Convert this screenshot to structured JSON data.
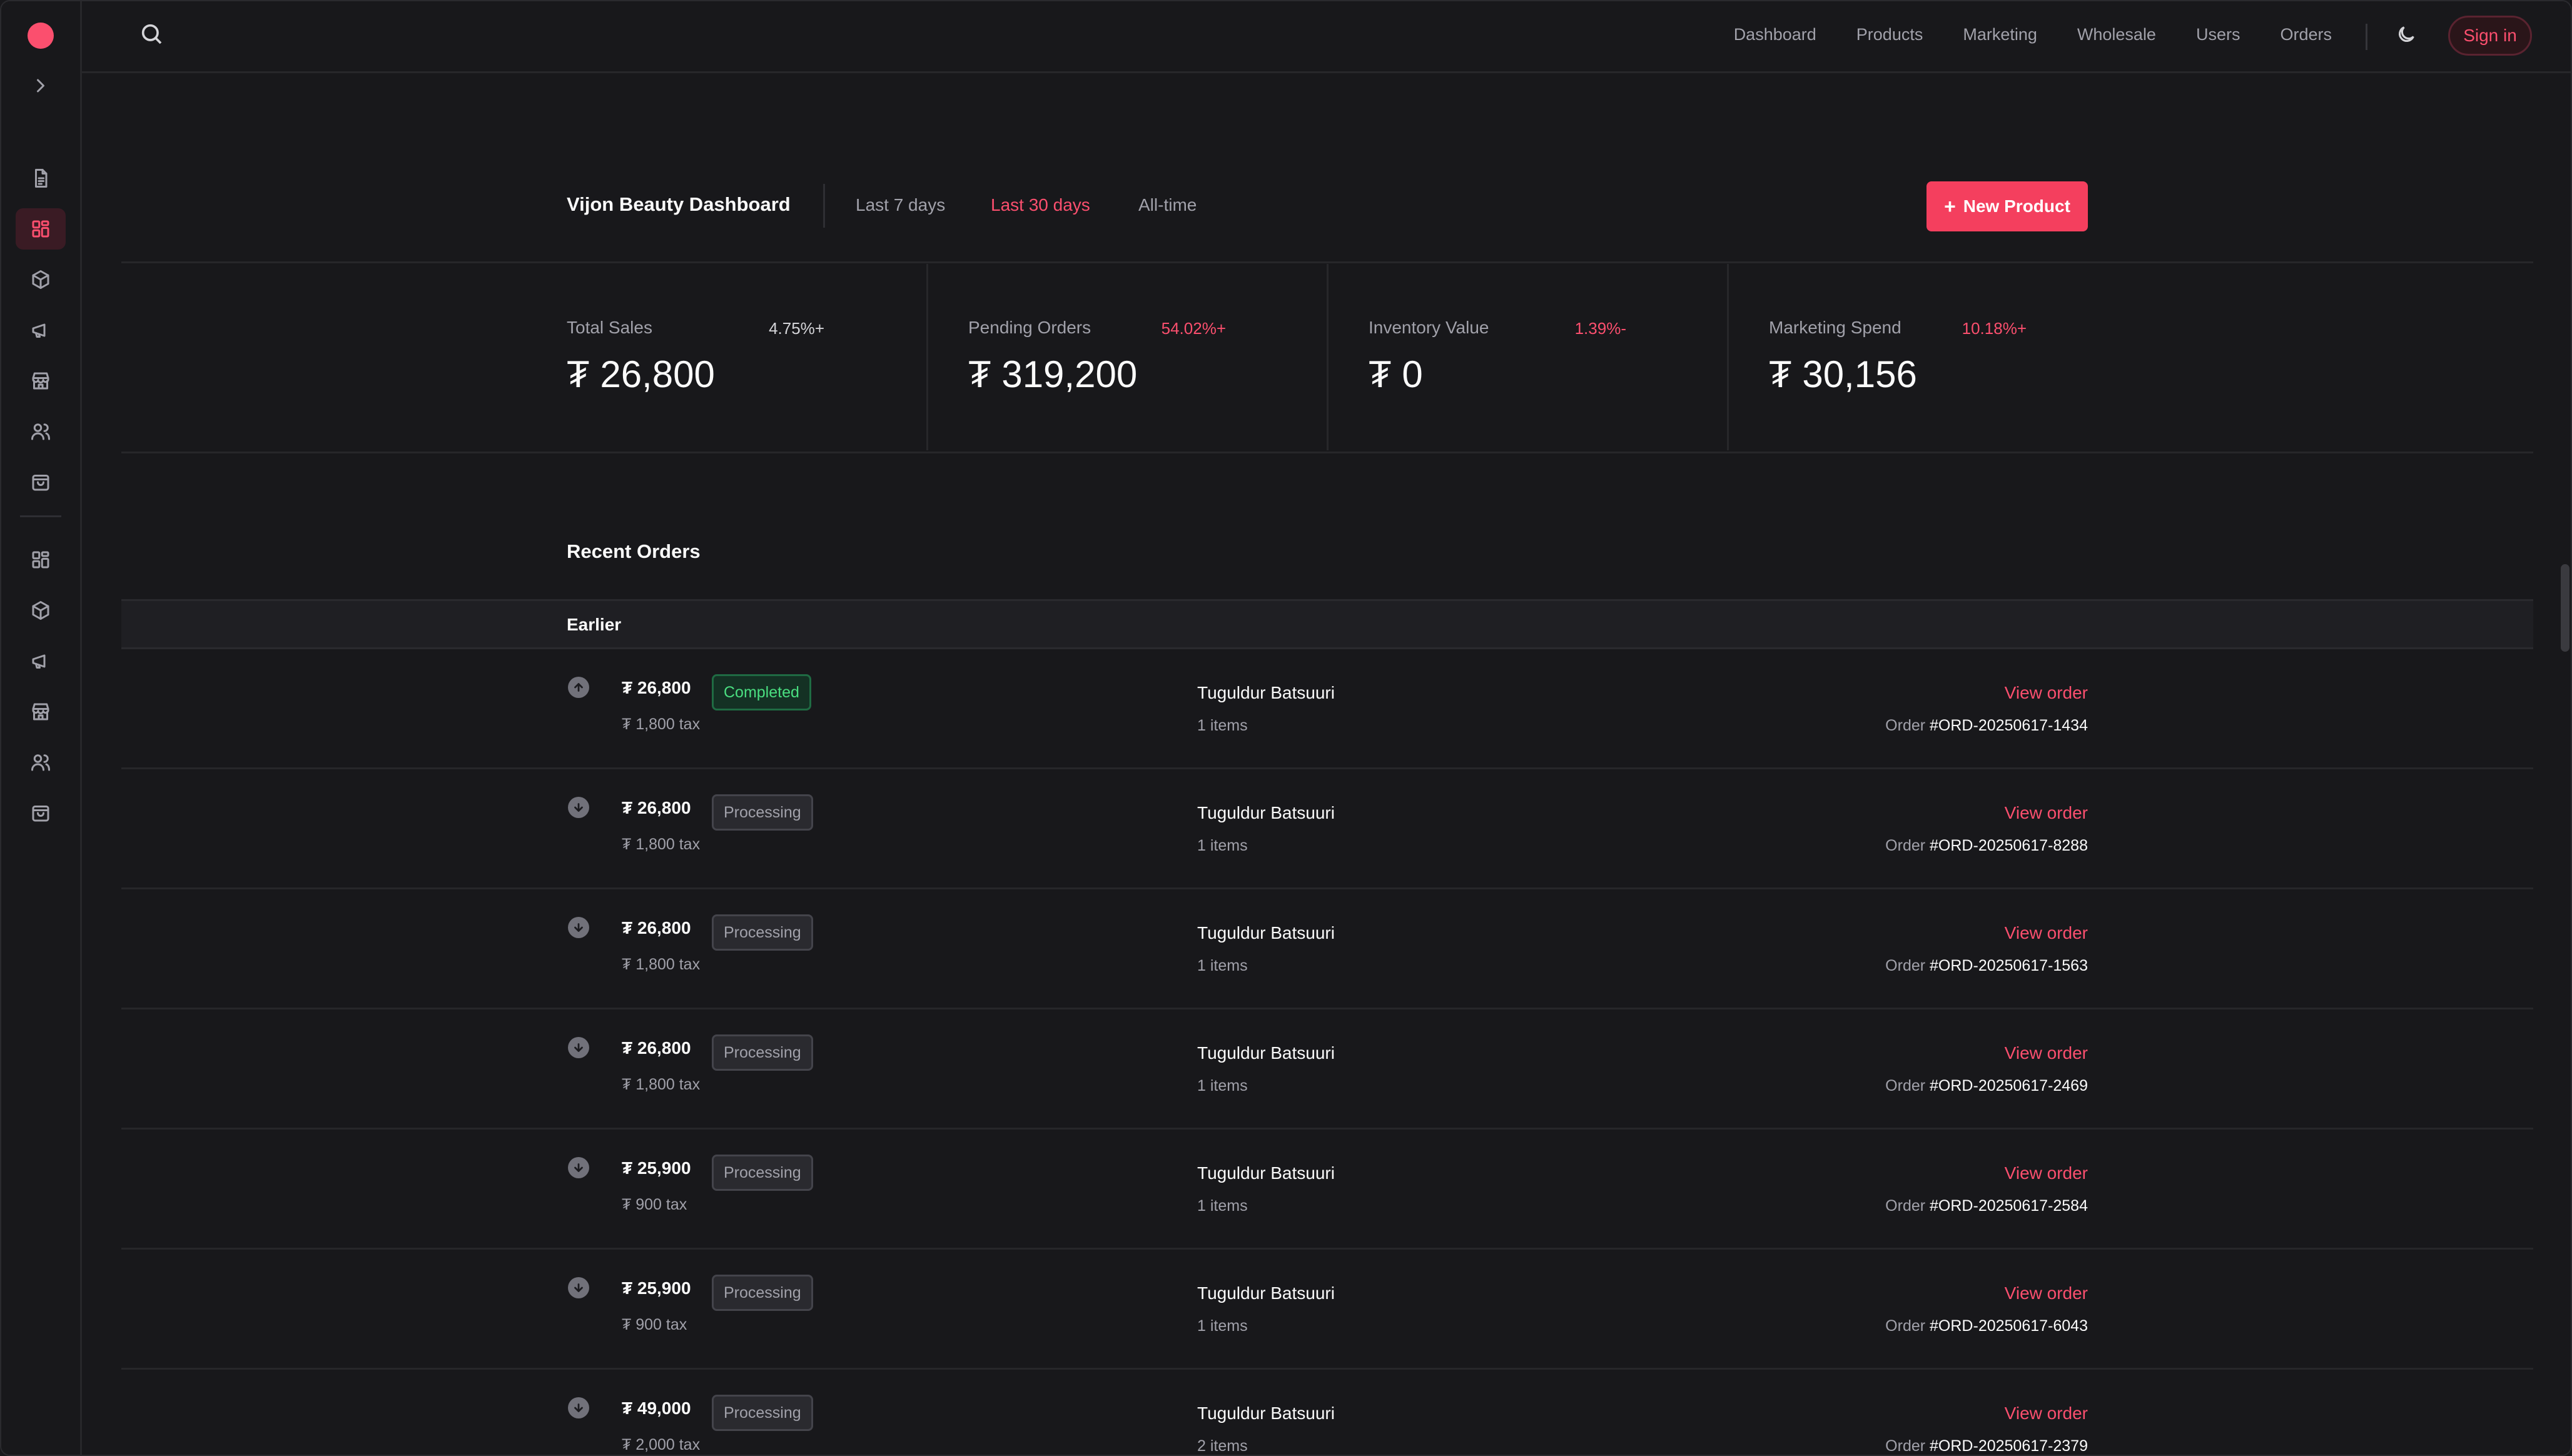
{
  "nav": {
    "items": [
      "Dashboard",
      "Products",
      "Marketing",
      "Wholesale",
      "Users",
      "Orders"
    ],
    "sign_in": "Sign in"
  },
  "sidebar": {
    "top_icons": [
      "document-icon",
      "dashboard-icon",
      "box-icon",
      "megaphone-icon",
      "store-icon",
      "users-icon",
      "bag-icon"
    ],
    "bottom_icons": [
      "dashboard-icon",
      "box-icon",
      "megaphone-icon",
      "store-icon",
      "users-icon",
      "bag-icon"
    ],
    "active_index": 1
  },
  "header": {
    "title": "Vijon Beauty Dashboard",
    "ranges": [
      "Last 7 days",
      "Last 30 days",
      "All-time"
    ],
    "active_range": "Last 30 days",
    "new_product": "New Product"
  },
  "stats": [
    {
      "label": "Total Sales",
      "change": "+4.75%",
      "value": "₮ 26,800",
      "change_color": "#d4d4d8"
    },
    {
      "label": "Pending Orders",
      "change": "+54.02%",
      "value": "₮ 319,200",
      "change_color": "#fb4f6e"
    },
    {
      "label": "Inventory Value",
      "change": "-1.39%",
      "value": "₮ 0",
      "change_color": "#fb4f6e"
    },
    {
      "label": "Marketing Spend",
      "change": "+10.18%",
      "value": "₮ 30,156",
      "change_color": "#fb4f6e"
    }
  ],
  "orders": {
    "title": "Recent Orders",
    "group": "Earlier",
    "view_label": "View order",
    "order_prefix": "Order",
    "rows": [
      {
        "direction": "up",
        "amount": "₮ 26,800",
        "tax": "₮ 1,800 tax",
        "status": "Completed",
        "customer": "Tuguldur Batsuuri",
        "items": "1 items",
        "id": "#ORD-20250617-1434"
      },
      {
        "direction": "down",
        "amount": "₮ 26,800",
        "tax": "₮ 1,800 tax",
        "status": "Processing",
        "customer": "Tuguldur Batsuuri",
        "items": "1 items",
        "id": "#ORD-20250617-8288"
      },
      {
        "direction": "down",
        "amount": "₮ 26,800",
        "tax": "₮ 1,800 tax",
        "status": "Processing",
        "customer": "Tuguldur Batsuuri",
        "items": "1 items",
        "id": "#ORD-20250617-1563"
      },
      {
        "direction": "down",
        "amount": "₮ 26,800",
        "tax": "₮ 1,800 tax",
        "status": "Processing",
        "customer": "Tuguldur Batsuuri",
        "items": "1 items",
        "id": "#ORD-20250617-2469"
      },
      {
        "direction": "down",
        "amount": "₮ 25,900",
        "tax": "₮ 900 tax",
        "status": "Processing",
        "customer": "Tuguldur Batsuuri",
        "items": "1 items",
        "id": "#ORD-20250617-2584"
      },
      {
        "direction": "down",
        "amount": "₮ 25,900",
        "tax": "₮ 900 tax",
        "status": "Processing",
        "customer": "Tuguldur Batsuuri",
        "items": "1 items",
        "id": "#ORD-20250617-6043"
      },
      {
        "direction": "down",
        "amount": "₮ 49,000",
        "tax": "₮ 2,000 tax",
        "status": "Processing",
        "customer": "Tuguldur Batsuuri",
        "items": "2 items",
        "id": "#ORD-20250617-2379"
      }
    ]
  }
}
